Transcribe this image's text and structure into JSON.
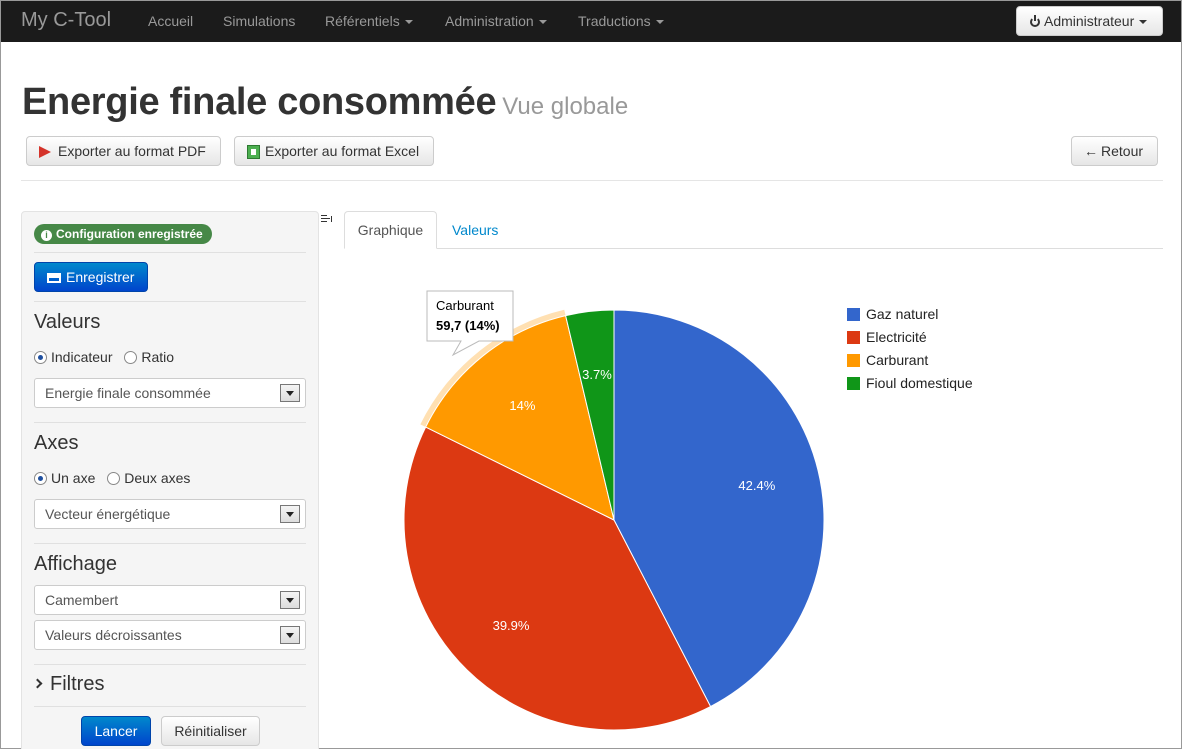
{
  "navbar": {
    "brand": "My C-Tool",
    "items": [
      {
        "label": "Accueil"
      },
      {
        "label": "Simulations"
      },
      {
        "label": "Référentiels"
      },
      {
        "label": "Administration"
      },
      {
        "label": "Traductions"
      }
    ],
    "user_label": "Administrateur"
  },
  "header": {
    "title": "Energie finale consommée",
    "subtitle": "Vue globale",
    "export_pdf": "Exporter au format PDF",
    "export_excel": "Exporter au format Excel",
    "back": "Retour"
  },
  "sidebar": {
    "badge": "Configuration enregistrée",
    "save": "Enregistrer",
    "values_title": "Valeurs",
    "values_options": [
      "Indicateur",
      "Ratio"
    ],
    "values_select": "Energie finale consommée",
    "axes_title": "Axes",
    "axes_options": [
      "Un axe",
      "Deux axes"
    ],
    "axes_select": "Vecteur énergétique",
    "display_title": "Affichage",
    "display_select": "Camembert",
    "sort_select": "Valeurs décroissantes",
    "filters_title": "Filtres",
    "launch": "Lancer",
    "reset": "Réinitialiser"
  },
  "tabs": [
    {
      "label": "Graphique",
      "active": true
    },
    {
      "label": "Valeurs",
      "active": false
    }
  ],
  "chart_data": {
    "type": "pie",
    "categories": [
      "Gaz naturel",
      "Electricité",
      "Carburant",
      "Fioul domestique"
    ],
    "values": [
      42.4,
      39.9,
      14,
      3.7
    ],
    "labels": [
      "42.4%",
      "39.9%",
      "14%",
      "3.7%"
    ],
    "colors": [
      "#3366cc",
      "#dc3912",
      "#ff9900",
      "#109618"
    ],
    "highlighted": "Carburant",
    "tooltip": {
      "title": "Carburant",
      "value": "59,7 (14%)"
    },
    "legend": "right"
  }
}
